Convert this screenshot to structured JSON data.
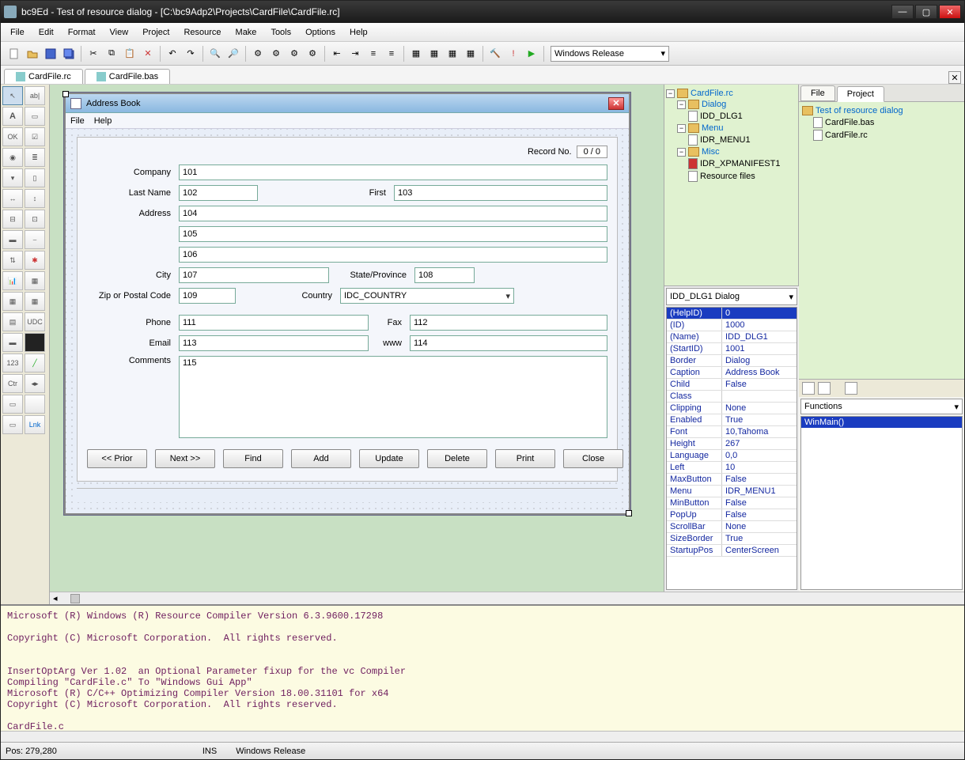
{
  "titlebar": {
    "title": "bc9Ed - Test of resource dialog - [C:\\bc9Adp2\\Projects\\CardFile\\CardFile.rc]"
  },
  "menu": [
    "File",
    "Edit",
    "Format",
    "View",
    "Project",
    "Resource",
    "Make",
    "Tools",
    "Options",
    "Help"
  ],
  "toolbar_select": "Windows Release",
  "filetabs": [
    "CardFile.rc",
    "CardFile.bas"
  ],
  "dialog": {
    "title": "Address Book",
    "menu": [
      "File",
      "Help"
    ],
    "record_label": "Record No.",
    "record_value": "0 / 0",
    "labels": {
      "company": "Company",
      "lastname": "Last Name",
      "first": "First",
      "address": "Address",
      "city": "City",
      "state": "State/Province",
      "zip": "Zip or Postal Code",
      "country": "Country",
      "phone": "Phone",
      "fax": "Fax",
      "email": "Email",
      "www": "www",
      "comments": "Comments"
    },
    "vals": {
      "company": "101",
      "lastname": "102",
      "first": "103",
      "addr1": "104",
      "addr2": "105",
      "addr3": "106",
      "city": "107",
      "state": "108",
      "zip": "109",
      "country": "IDC_COUNTRY",
      "phone": "111",
      "fax": "112",
      "email": "113",
      "www": "114",
      "comments": "115"
    },
    "buttons": [
      "<<  Prior",
      "Next  >>",
      "Find",
      "Add",
      "Update",
      "Delete",
      "Print",
      "Close"
    ]
  },
  "explorer": {
    "root": "CardFile.rc",
    "dlg_folder": "Dialog",
    "dlg_item": "IDD_DLG1",
    "menu_folder": "Menu",
    "menu_item": "IDR_MENU1",
    "misc_folder": "Misc",
    "misc_item": "IDR_XPMANIFEST1",
    "misc_item2": "Resource files"
  },
  "project_tabs": {
    "file": "File",
    "project": "Project"
  },
  "project_tree": {
    "root": "Test of resource dialog",
    "f1": "CardFile.bas",
    "f2": "CardFile.rc"
  },
  "props_head": "IDD_DLG1 Dialog",
  "props": [
    [
      "(HelpID)",
      "0"
    ],
    [
      "(ID)",
      "1000"
    ],
    [
      "(Name)",
      "IDD_DLG1"
    ],
    [
      "(StartID)",
      "1001"
    ],
    [
      "Border",
      "Dialog"
    ],
    [
      "Caption",
      "Address Book"
    ],
    [
      "Child",
      "False"
    ],
    [
      "Class",
      ""
    ],
    [
      "Clipping",
      "None"
    ],
    [
      "Enabled",
      "True"
    ],
    [
      "Font",
      "10,Tahoma"
    ],
    [
      "Height",
      "267"
    ],
    [
      "Language",
      "0,0"
    ],
    [
      "Left",
      "10"
    ],
    [
      "MaxButton",
      "False"
    ],
    [
      "Menu",
      "IDR_MENU1"
    ],
    [
      "MinButton",
      "False"
    ],
    [
      "PopUp",
      "False"
    ],
    [
      "ScrollBar",
      "None"
    ],
    [
      "SizeBorder",
      "True"
    ],
    [
      "StartupPos",
      "CenterScreen"
    ]
  ],
  "func_select": "Functions",
  "func_item": "WinMain()",
  "output": "Microsoft (R) Windows (R) Resource Compiler Version 6.3.9600.17298\n\nCopyright (C) Microsoft Corporation.  All rights reserved.\n\n\nInsertOptArg Ver 1.02  an Optional Parameter fixup for the vc Compiler\nCompiling \"CardFile.c\" To \"Windows Gui App\"\nMicrosoft (R) C/C++ Optimizing Compiler Version 18.00.31101 for x64\nCopyright (C) Microsoft Corporation.  All rights reserved.\n\nCardFile.c",
  "status": {
    "pos": "Pos: 279,280",
    "ins": "INS",
    "build": "Windows Release"
  }
}
